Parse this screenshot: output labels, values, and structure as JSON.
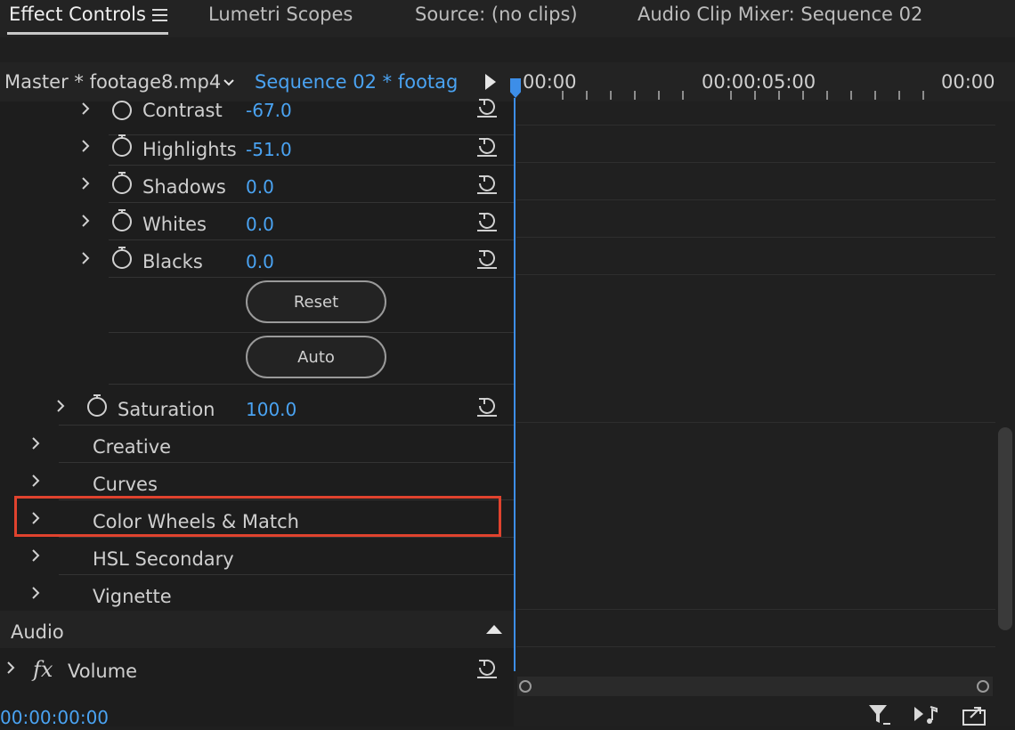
{
  "tabs": [
    {
      "label": "Effect Controls",
      "active": true
    },
    {
      "label": "Lumetri Scopes"
    },
    {
      "label": "Source: (no clips)"
    },
    {
      "label": "Audio Clip Mixer: Sequence 02"
    }
  ],
  "effect_controls": {
    "master_label": "Master * footage8.mp4",
    "sequence_label": "Sequence 02 * footag...",
    "params": [
      {
        "label": "Contrast",
        "value": "-67.0"
      },
      {
        "label": "Highlights",
        "value": "-51.0"
      },
      {
        "label": "Shadows",
        "value": "0.0"
      },
      {
        "label": "Whites",
        "value": "0.0"
      },
      {
        "label": "Blacks",
        "value": "0.0"
      }
    ],
    "buttons": {
      "reset": "Reset",
      "auto": "Auto"
    },
    "saturation": {
      "label": "Saturation",
      "value": "100.0"
    },
    "groups": [
      "Creative",
      "Curves",
      "Color Wheels & Match",
      "HSL Secondary",
      "Vignette"
    ],
    "highlighted_group": "Color Wheels & Match",
    "audio_section": "Audio",
    "audio_effect": {
      "fx": "fx",
      "label": "Volume"
    },
    "timecode": "00:00:00:00"
  },
  "timeline": {
    "ruler_times": [
      "00:00",
      "00:00:05:00",
      "00:00"
    ],
    "playhead_color": "#3d8ee8"
  },
  "colors": {
    "accent_blue": "#4aa3f2",
    "highlight_red": "#e0432e"
  },
  "icons": [
    "hamburger-menu-icon",
    "chevron-down-icon",
    "play-triangle-icon",
    "stopwatch-icon",
    "reset-arrow-icon",
    "collapse-up-icon",
    "filter-icon",
    "play-audio-icon",
    "export-icon"
  ]
}
